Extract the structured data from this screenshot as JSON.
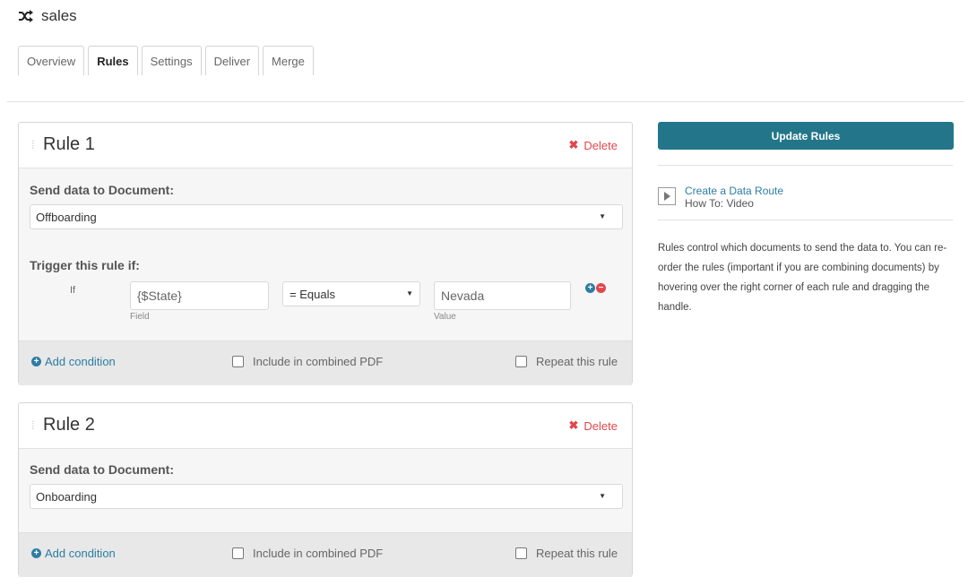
{
  "header": {
    "title": "sales",
    "icon": "shuffle-icon"
  },
  "tabs": [
    {
      "label": "Overview",
      "active": false
    },
    {
      "label": "Rules",
      "active": true
    },
    {
      "label": "Settings",
      "active": false
    },
    {
      "label": "Deliver",
      "active": false
    },
    {
      "label": "Merge",
      "active": false
    }
  ],
  "rules": [
    {
      "title": "Rule 1",
      "delete_label": "Delete",
      "send_label": "Send data to Document:",
      "document": "Offboarding",
      "trigger_label": "Trigger this rule if:",
      "condition": {
        "if_label": "If",
        "field": "{$State}",
        "field_caption": "Field",
        "operator": "= Equals",
        "value": "Nevada",
        "value_caption": "Value"
      },
      "add_condition": "Add condition",
      "include_pdf": "Include in combined PDF",
      "repeat": "Repeat this rule"
    },
    {
      "title": "Rule 2",
      "delete_label": "Delete",
      "send_label": "Send data to Document:",
      "document": "Onboarding",
      "add_condition": "Add condition",
      "include_pdf": "Include in combined PDF",
      "repeat": "Repeat this rule"
    }
  ],
  "sidebar": {
    "update_button": "Update Rules",
    "video_link": "Create a Data Route",
    "video_caption": "How To: Video",
    "help_text": "Rules control which documents to send the data to. You can re-order the rules (important if you are combining documents) by hovering over the right corner of each rule and dragging the handle."
  },
  "colors": {
    "accent": "#237689",
    "link": "#2d7da3",
    "delete": "#e0474c"
  }
}
